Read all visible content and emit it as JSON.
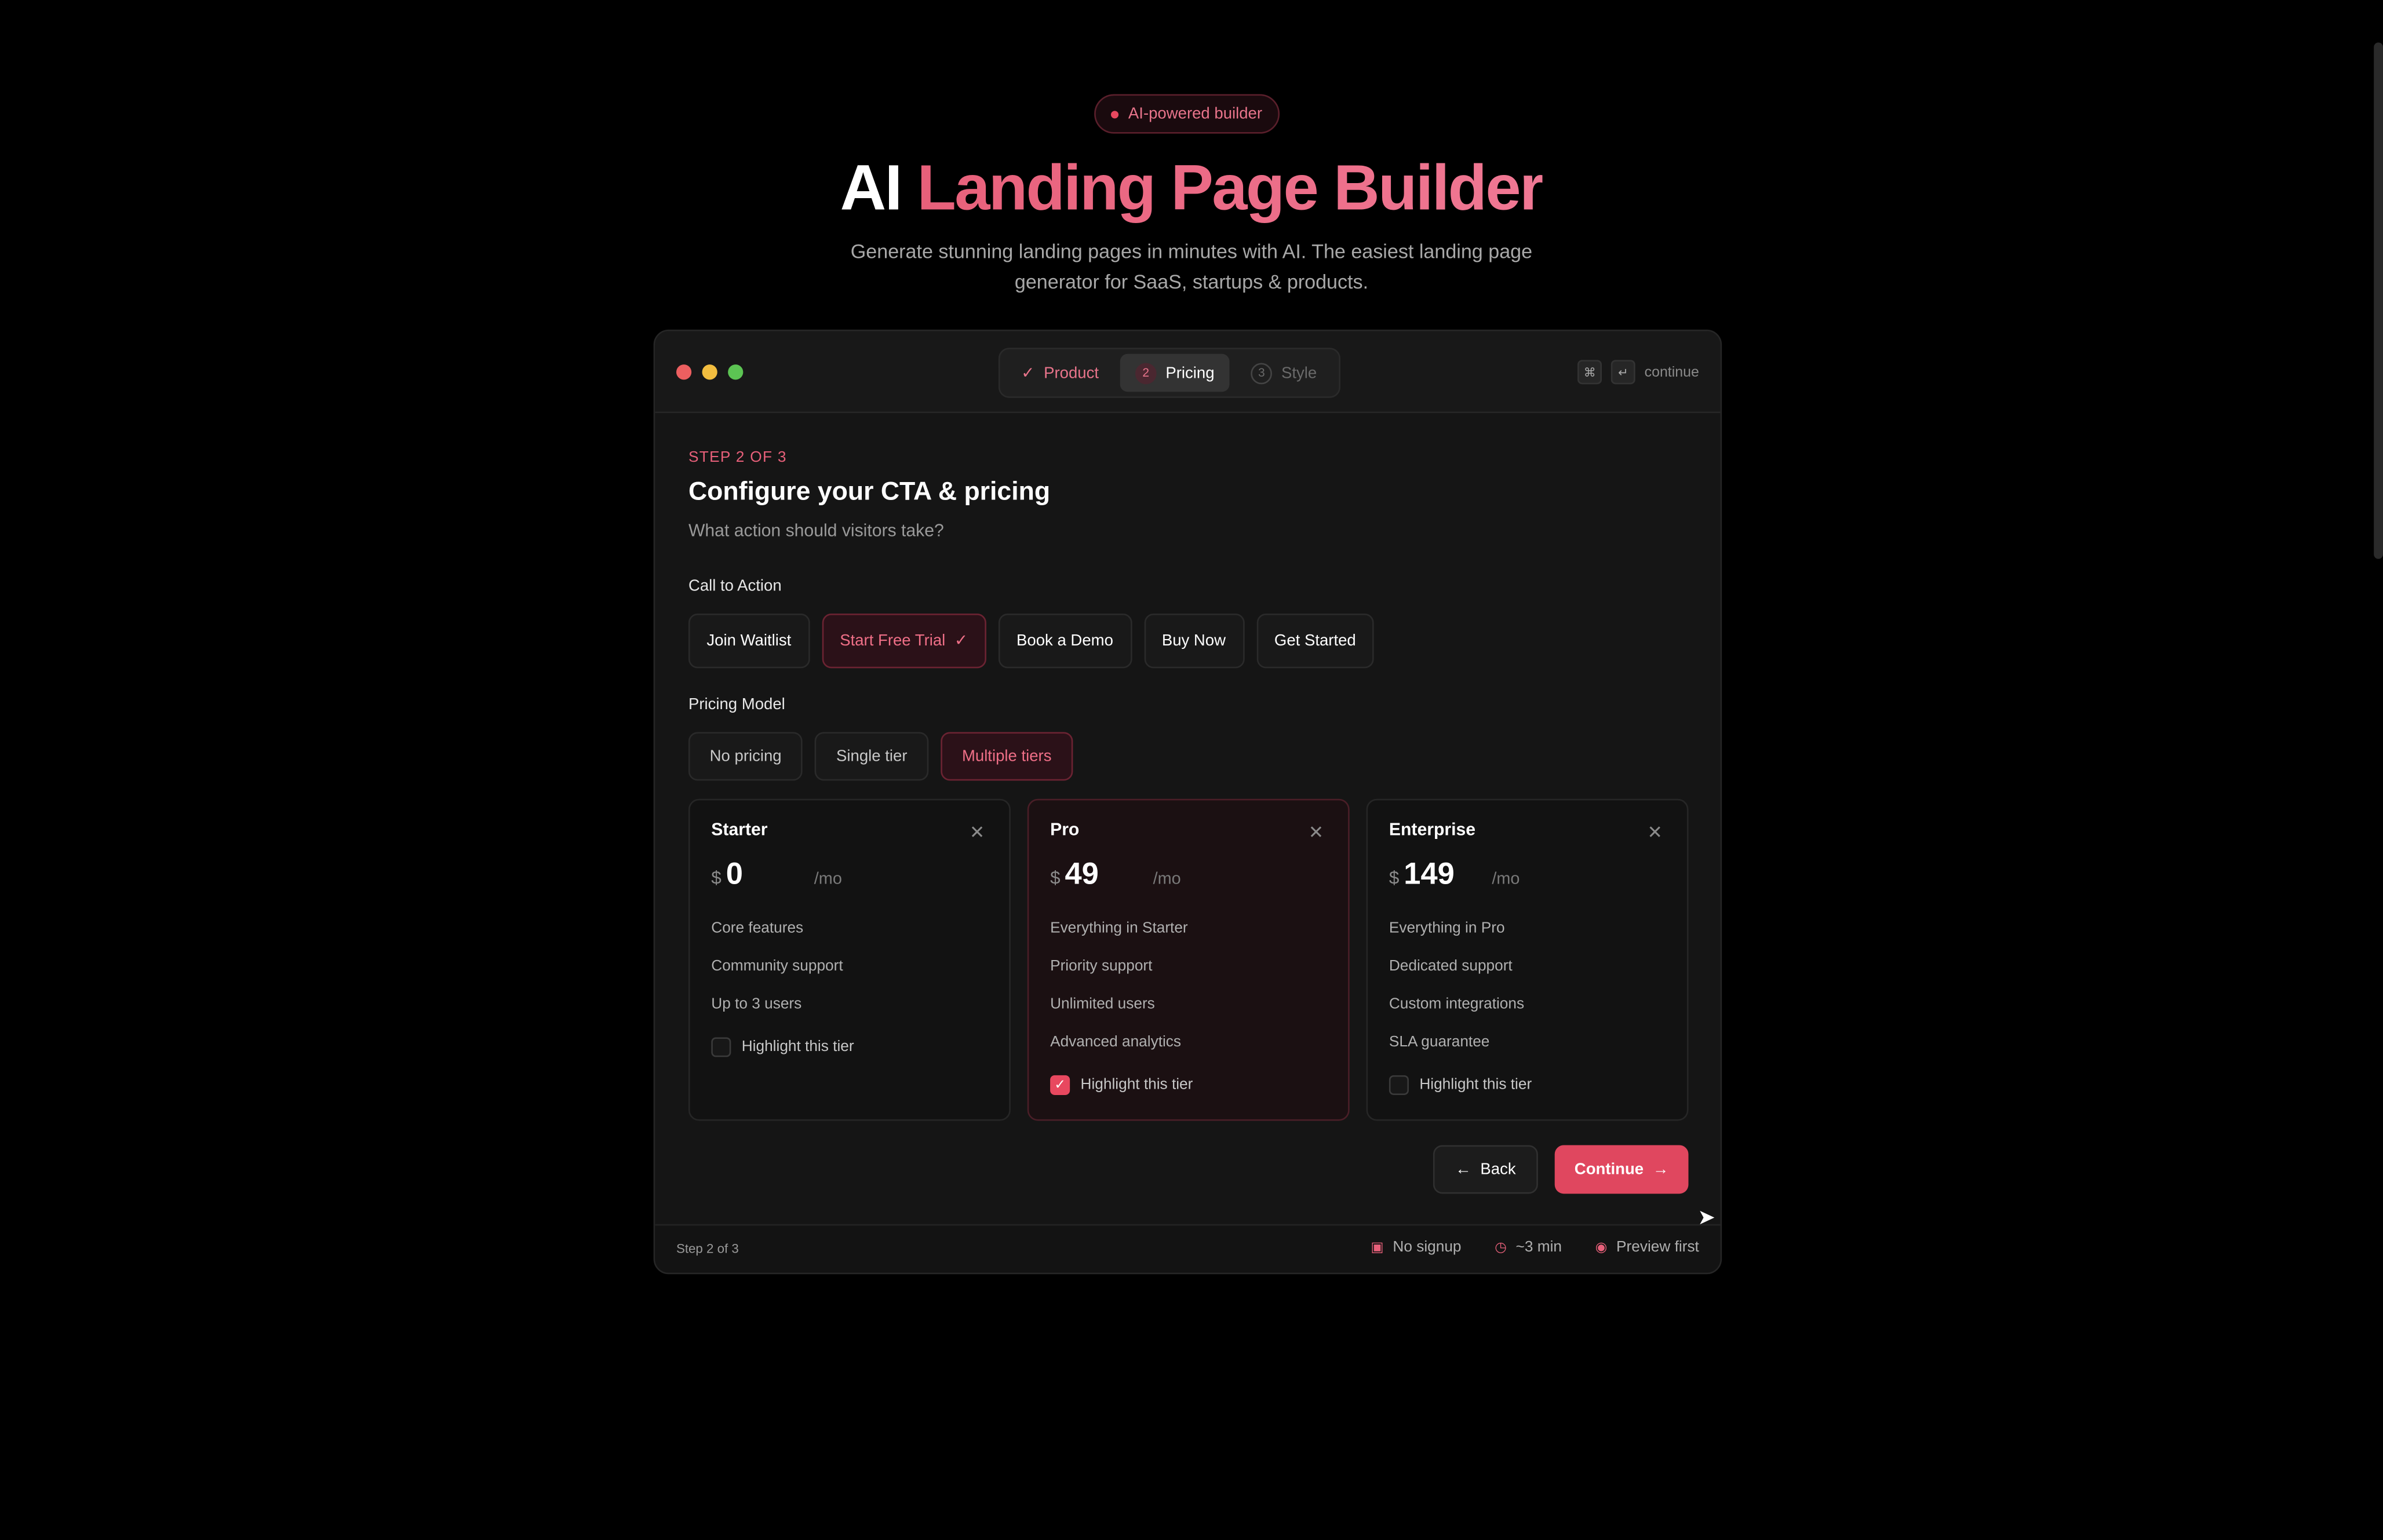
{
  "hero": {
    "badge": "AI-powered builder",
    "title_plain": "AI",
    "title_accent": "Landing Page Builder",
    "subtitle_line1": "Generate stunning landing pages in minutes with AI. The easiest landing page",
    "subtitle_line2": "generator for SaaS, startups & products."
  },
  "window": {
    "steps": [
      {
        "label": "Product",
        "state": "done"
      },
      {
        "label": "Pricing",
        "num": "2",
        "state": "active"
      },
      {
        "label": "Style",
        "num": "3",
        "state": "todo"
      }
    ],
    "kbd_hint": "continue"
  },
  "form": {
    "step_label": "STEP 2 OF 3",
    "heading": "Configure your CTA & pricing",
    "subheading": "What action should visitors take?",
    "cta_label": "Call to Action",
    "cta_options": [
      "Join Waitlist",
      "Start Free Trial",
      "Book a Demo",
      "Buy Now",
      "Get Started"
    ],
    "cta_selected": "Start Free Trial",
    "pricing_label": "Pricing Model",
    "pricing_options": [
      "No pricing",
      "Single tier",
      "Multiple tiers"
    ],
    "pricing_selected": "Multiple tiers",
    "tiers": [
      {
        "name": "Starter",
        "currency": "$",
        "price": "0",
        "period": "/mo",
        "features": [
          "Core features",
          "Community support",
          "Up to 3 users"
        ],
        "highlight_label": "Highlight this tier",
        "highlighted": false
      },
      {
        "name": "Pro",
        "currency": "$",
        "price": "49",
        "period": "/mo",
        "features": [
          "Everything in Starter",
          "Priority support",
          "Unlimited users",
          "Advanced analytics"
        ],
        "highlight_label": "Highlight this tier",
        "highlighted": true
      },
      {
        "name": "Enterprise",
        "currency": "$",
        "price": "149",
        "period": "/mo",
        "features": [
          "Everything in Pro",
          "Dedicated support",
          "Custom integrations",
          "SLA guarantee"
        ],
        "highlight_label": "Highlight this tier",
        "highlighted": false
      }
    ],
    "back_label": "Back",
    "continue_label": "Continue"
  },
  "footer": {
    "step_text": "Step 2 of 3",
    "items": [
      "No signup",
      "~3 min",
      "Preview first"
    ]
  },
  "colors": {
    "accent": "#e0475f",
    "background": "#000000",
    "panel": "#151515"
  }
}
